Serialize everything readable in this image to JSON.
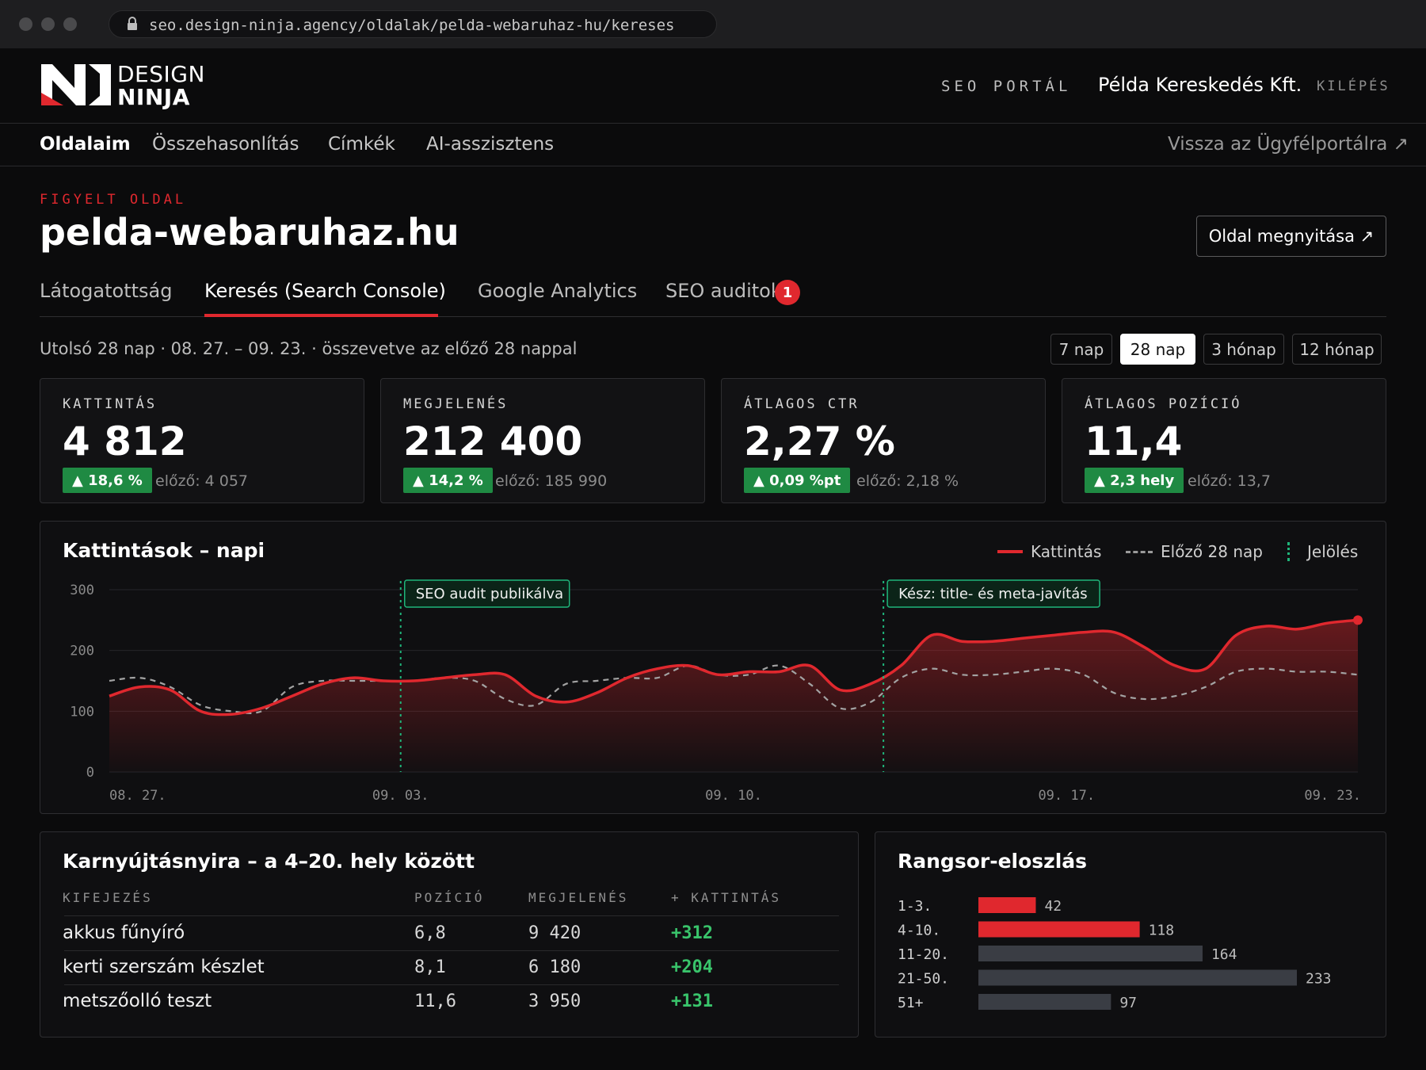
{
  "browser": {
    "url": "seo.design-ninja.agency/oldalak/pelda-webaruhaz-hu/kereses"
  },
  "header": {
    "logo_line1": "DESIGN",
    "logo_line2": "NINJA",
    "portal_label": "SEO PORTÁL",
    "company": "Példa Kereskedés Kft.",
    "logout": "KILÉPÉS"
  },
  "subnav": {
    "items": [
      {
        "label": "Oldalaim",
        "active": true
      },
      {
        "label": "Összehasonlítás",
        "active": false
      },
      {
        "label": "Címkék",
        "active": false
      },
      {
        "label": "AI-asszisztens",
        "active": false
      }
    ],
    "back_link": "Vissza az Ügyfélportálra ↗"
  },
  "page": {
    "eyebrow": "FIGYELT OLDAL",
    "title": "pelda-webaruhaz.hu",
    "open_button": "Oldal megnyitása ↗"
  },
  "tabs": [
    {
      "label": "Látogatottság",
      "active": false
    },
    {
      "label": "Keresés (Search Console)",
      "active": true
    },
    {
      "label": "Google Analytics",
      "active": false
    },
    {
      "label": "SEO auditok",
      "active": false,
      "badge": "1"
    }
  ],
  "period": {
    "summary": "Utolsó 28 nap · 08. 27. – 09. 23. · összevetve az előző 28 nappal",
    "ranges": [
      {
        "label": "7 nap",
        "active": false
      },
      {
        "label": "28 nap",
        "active": true
      },
      {
        "label": "3 hónap",
        "active": false
      },
      {
        "label": "12 hónap",
        "active": false
      }
    ]
  },
  "kpis": [
    {
      "label": "KATTINTÁS",
      "value": "4 812",
      "change": "▲ 18,6 %",
      "previous": "előző: 4 057"
    },
    {
      "label": "MEGJELENÉS",
      "value": "212 400",
      "change": "▲ 14,2 %",
      "previous": "előző: 185 990"
    },
    {
      "label": "ÁTLAGOS CTR",
      "value": "2,27 %",
      "change": "▲ 0,09 %pt",
      "previous": "előző: 2,18 %"
    },
    {
      "label": "ÁTLAGOS POZÍCIÓ",
      "value": "11,4",
      "change": "▲ 2,3 hely",
      "previous": "előző: 13,7"
    }
  ],
  "colors": {
    "accent": "#e0282e",
    "positive": "#1f8a43",
    "positive_text": "#39c46b",
    "annotation": "#1fb57a",
    "neutral_bar": "#3a3d44"
  },
  "chart_data": [
    {
      "type": "line",
      "title": "Kattintások – napi",
      "legend": [
        "Kattintás",
        "Előző 28 nap",
        "Jelölés"
      ],
      "legend_position": "top-right",
      "y_ticks": [
        "300",
        "200",
        "100",
        "0"
      ],
      "ylim": [
        0,
        300
      ],
      "x_ticks": [
        "08. 27.",
        "09. 03.",
        "09. 10.",
        "09. 17.",
        "09. 23."
      ],
      "x_tick_days": [
        0,
        7,
        15,
        23,
        29
      ],
      "x_days": 30,
      "series": [
        {
          "name": "Kattintás",
          "values": [
            125,
            140,
            135,
            100,
            95,
            105,
            125,
            145,
            155,
            150,
            150,
            155,
            160,
            160,
            125,
            115,
            130,
            155,
            170,
            175,
            160,
            165,
            165,
            175,
            135,
            145,
            175,
            225,
            215,
            215,
            220,
            225,
            230,
            230,
            205,
            175,
            170,
            225,
            240,
            235,
            245,
            250
          ]
        },
        {
          "name": "Előző 28 nap",
          "values": [
            150,
            155,
            140,
            110,
            100,
            100,
            140,
            150,
            150,
            150,
            150,
            155,
            150,
            120,
            110,
            145,
            150,
            155,
            155,
            175,
            160,
            160,
            175,
            145,
            105,
            115,
            155,
            170,
            160,
            160,
            165,
            170,
            160,
            130,
            120,
            125,
            140,
            165,
            170,
            165,
            165,
            160
          ]
        }
      ],
      "annotations": [
        {
          "day": 7,
          "label": "SEO audit publikálva"
        },
        {
          "day": 18.6,
          "label": "Kész: title- és meta-javítás"
        }
      ]
    },
    {
      "type": "bar",
      "title": "Rangsor-eloszlás",
      "categories": [
        "1-3.",
        "4-10.",
        "11-20.",
        "21-50.",
        "51+"
      ],
      "values": [
        42,
        118,
        164,
        233,
        97
      ],
      "highlight": [
        true,
        true,
        false,
        false,
        false
      ]
    }
  ],
  "striking": {
    "title": "Karnyújtásnyira – a 4–20. hely között",
    "headers": [
      "KIFEJEZÉS",
      "POZÍCIÓ",
      "MEGJELENÉS",
      "+ KATTINTÁS"
    ],
    "rows": [
      [
        "akkus fűnyíró",
        "6,8",
        "9 420",
        "+312"
      ],
      [
        "kerti szerszám készlet",
        "8,1",
        "6 180",
        "+204"
      ],
      [
        "metszőolló teszt",
        "11,6",
        "3 950",
        "+131"
      ]
    ]
  }
}
